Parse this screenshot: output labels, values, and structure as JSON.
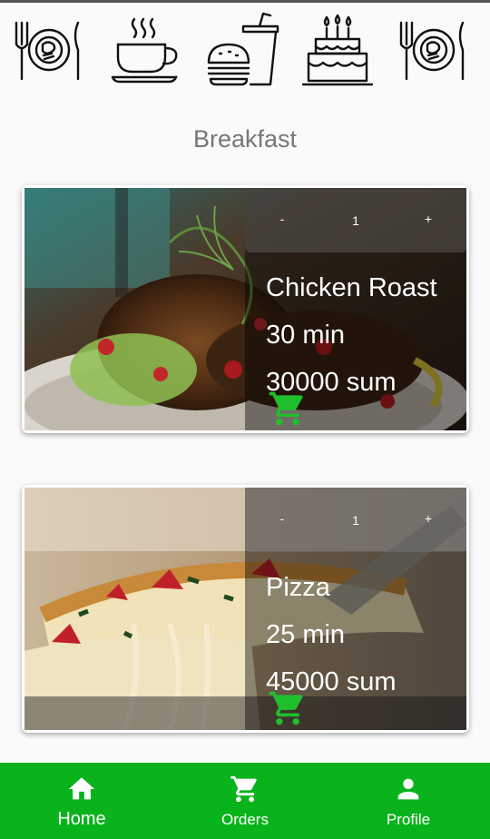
{
  "categories": [
    {
      "name": "plate-cutlery-icon",
      "label": ""
    },
    {
      "name": "coffee-cup-icon",
      "label": ""
    },
    {
      "name": "burger-drink-icon",
      "label": ""
    },
    {
      "name": "birthday-cake-icon",
      "label": ""
    },
    {
      "name": "plate-cutlery-icon",
      "label": ""
    }
  ],
  "section": {
    "title": "Breakfast"
  },
  "items": [
    {
      "name": "Chicken Roast",
      "time": "30 min",
      "price": "30000 sum",
      "qty": "1",
      "minus_label": "-",
      "plus_label": "+",
      "image": "chicken-roast-photo"
    },
    {
      "name": "Pizza",
      "time": "25 min",
      "price": "45000 sum",
      "qty": "1",
      "minus_label": "-",
      "plus_label": "+",
      "image": "pizza-photo"
    }
  ],
  "nav": {
    "items": [
      {
        "label": "Home",
        "icon": "home-icon",
        "active": true
      },
      {
        "label": "Orders",
        "icon": "cart-icon",
        "active": false
      },
      {
        "label": "Profile",
        "icon": "person-icon",
        "active": false
      }
    ]
  },
  "colors": {
    "accent": "#09b31b",
    "cart": "#1fbf2c",
    "title": "#777777",
    "background": "#fafafa"
  }
}
